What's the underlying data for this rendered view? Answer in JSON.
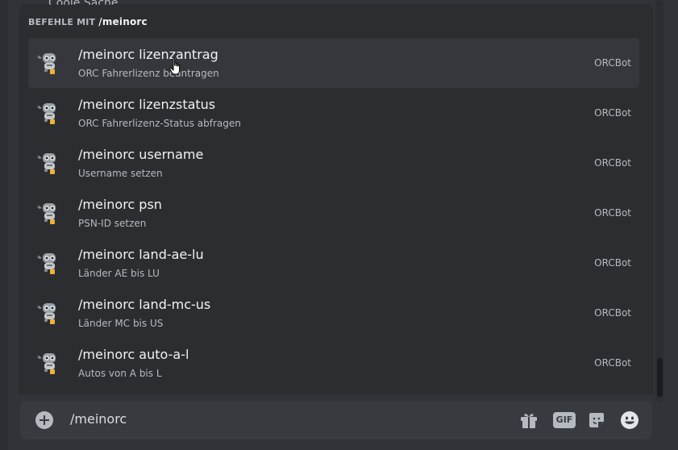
{
  "background": {
    "peek_text": "Coole Sache"
  },
  "popup": {
    "header_prefix": "BEFEHLE MIT",
    "header_command": "/meinorc",
    "commands": [
      {
        "name": "/meinorc lizenzantrag",
        "description": "ORC Fahrerlizenz beantragen",
        "source": "ORCBot",
        "selected": true
      },
      {
        "name": "/meinorc lizenzstatus",
        "description": "ORC Fahrerlizenz-Status abfragen",
        "source": "ORCBot"
      },
      {
        "name": "/meinorc username",
        "description": "Username setzen",
        "source": "ORCBot"
      },
      {
        "name": "/meinorc psn",
        "description": "PSN-ID setzen",
        "source": "ORCBot"
      },
      {
        "name": "/meinorc land-ae-lu",
        "description": "Länder AE bis LU",
        "source": "ORCBot"
      },
      {
        "name": "/meinorc land-mc-us",
        "description": "Länder MC bis US",
        "source": "ORCBot"
      },
      {
        "name": "/meinorc auto-a-l",
        "description": "Autos von A bis L",
        "source": "ORCBot"
      }
    ]
  },
  "input": {
    "value": "/meinorc",
    "gif_label": "GIF"
  },
  "icons": {
    "add": "plus-circle-icon",
    "gift": "gift-icon",
    "gif": "gif-icon",
    "sticker": "sticker-icon",
    "emoji": "emoji-icon",
    "bot_avatar": "robot-avatar-icon"
  },
  "colors": {
    "background": "#313338",
    "popup": "#2b2d31",
    "selected_row": "#35373c",
    "input_bar": "#383a40",
    "spellcheck": "#f23f43"
  }
}
